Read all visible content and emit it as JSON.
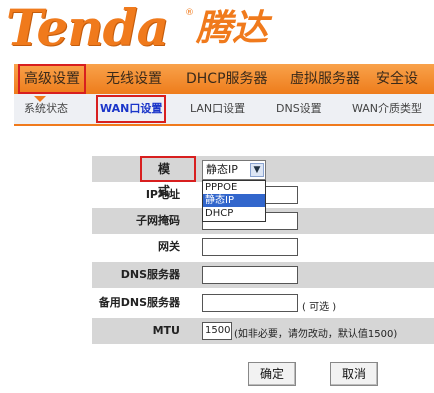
{
  "logo": {
    "brand_en": "Tenda",
    "mark": "®",
    "brand_cn": "腾达"
  },
  "main_nav": {
    "tabs": [
      {
        "label": "高级设置"
      },
      {
        "label": "无线设置"
      },
      {
        "label": "DHCP服务器"
      },
      {
        "label": "虚拟服务器"
      },
      {
        "label": "安全设"
      }
    ],
    "active_index": 0
  },
  "sub_nav": {
    "tabs": [
      {
        "label": "系统状态"
      },
      {
        "label": "WAN口设置"
      },
      {
        "label": "LAN口设置"
      },
      {
        "label": "DNS设置"
      },
      {
        "label": "WAN介质类型"
      }
    ],
    "active_index": 1
  },
  "form": {
    "mode_label": "模 式",
    "mode_value": "静态IP",
    "mode_options": [
      "PPPOE",
      "静态IP",
      "DHCP"
    ],
    "mode_selected_option": "静态IP",
    "ip_label": "IP地址",
    "ip_value": "",
    "subnet_label": "子网掩码",
    "subnet_value": "",
    "gateway_label": "网关",
    "gateway_value": "",
    "dns_label": "DNS服务器",
    "dns_value": "",
    "dns2_label": "备用DNS服务器",
    "dns2_value": "",
    "dns2_hint": "( 可选 )",
    "mtu_label": "MTU",
    "mtu_value": "1500",
    "mtu_hint": "(如非必要，请勿改动，默认值1500)"
  },
  "buttons": {
    "confirm": "确定",
    "cancel": "取消"
  },
  "colors": {
    "accent": "#f07a1c",
    "highlight": "#d81f1f",
    "link_active": "#1a35c9",
    "row_shade": "#d6d6d6"
  }
}
